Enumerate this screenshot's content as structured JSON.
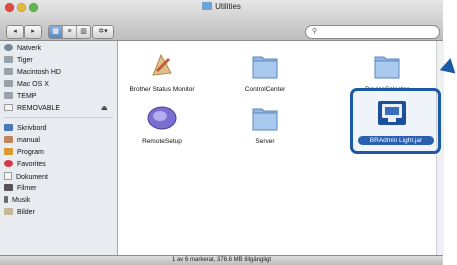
{
  "window": {
    "title": "Utilities"
  },
  "toolbar": {
    "back_label": "◂",
    "forward_label": "▸",
    "views": [
      "▦",
      "≡",
      "▥"
    ],
    "action_label": "✲▾",
    "search_placeholder": ""
  },
  "sidebar": {
    "devices": [
      {
        "label": "Natverk",
        "icon": "network-icon"
      },
      {
        "label": "Tiger",
        "icon": "hard-drive-icon"
      },
      {
        "label": "Macintosh HD",
        "icon": "hard-drive-icon"
      },
      {
        "label": "Mac OS X",
        "icon": "hard-drive-icon"
      },
      {
        "label": "TEMP",
        "icon": "hard-drive-icon"
      },
      {
        "label": "REMOVABLE",
        "icon": "removable-drive-icon"
      }
    ],
    "places": [
      {
        "label": "Skrivbord",
        "icon": "desktop-icon"
      },
      {
        "label": "manual",
        "icon": "home-icon"
      },
      {
        "label": "Program",
        "icon": "applications-icon"
      },
      {
        "label": "Favorites",
        "icon": "heart-icon"
      },
      {
        "label": "Dokument",
        "icon": "document-icon"
      },
      {
        "label": "Filmer",
        "icon": "movie-icon"
      },
      {
        "label": "Musik",
        "icon": "music-icon"
      },
      {
        "label": "Bilder",
        "icon": "pictures-icon"
      }
    ],
    "eject": "⏏"
  },
  "items": [
    {
      "label": "Brother Status Monitor"
    },
    {
      "label": "ControlCenter"
    },
    {
      "label": "DeviceSelector"
    },
    {
      "label": "RemoteSetup"
    },
    {
      "label": "Server"
    },
    {
      "label": "BRAdmin Light.jar"
    }
  ],
  "status_bar": {
    "text": "1 av 6 markerat, 378.6 MB tillgängligt"
  },
  "colors": {
    "highlight": "#1b5aa6",
    "folder": "#8fb8e6"
  }
}
